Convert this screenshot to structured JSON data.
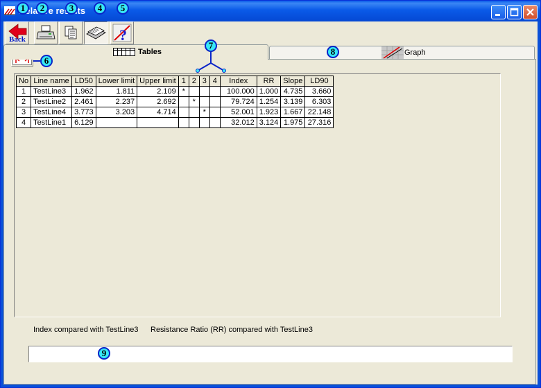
{
  "window": {
    "title": "Relative results"
  },
  "toolbar": {
    "back_label": "Back",
    "buttons": [
      "back-icon",
      "printer-icon",
      "copy-icon",
      "save-icon",
      "help-icon"
    ]
  },
  "tabs": [
    {
      "label": "Tables",
      "active": true
    },
    {
      "label": "Graph",
      "active": false
    }
  ],
  "table": {
    "columns": [
      "No",
      "Line name",
      "LD50",
      "Lower limit",
      "Upper limit",
      "1",
      "2",
      "3",
      "4",
      "Index",
      "RR",
      "Slope",
      "LD90"
    ],
    "rows": [
      [
        "1",
        "TestLine3",
        "1.962",
        "1.811",
        "2.109",
        "*",
        "",
        "",
        "",
        "100.000",
        "1.000",
        "4.735",
        "3.660"
      ],
      [
        "2",
        "TestLine2",
        "2.461",
        "2.237",
        "2.692",
        "",
        "*",
        "",
        "",
        "79.724",
        "1.254",
        "3.139",
        "6.303"
      ],
      [
        "3",
        "TestLine4",
        "3.773",
        "3.203",
        "4.714",
        "",
        "",
        "*",
        "",
        "52.001",
        "1.923",
        "1.667",
        "22.148"
      ],
      [
        "4",
        "TestLine1",
        "6.129",
        "",
        "",
        "",
        "",
        "",
        "",
        "32.012",
        "3.124",
        "1.975",
        "27.316"
      ]
    ]
  },
  "footer": {
    "index_note": "Index compared with TestLine3",
    "rr_note": "Resistance Ratio (RR) compared with TestLine3"
  },
  "status_text": "",
  "callouts": [
    "1",
    "2",
    "3",
    "4",
    "5",
    "6",
    "7",
    "8",
    "9"
  ]
}
